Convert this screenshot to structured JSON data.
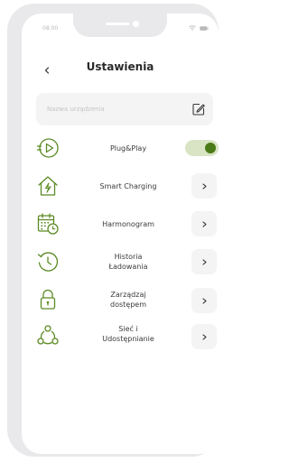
{
  "status_bar": {
    "time": "08.00"
  },
  "header": {
    "title": "Ustawienia"
  },
  "device_name": {
    "placeholder": "Nazwa urządzenia"
  },
  "accent_color": "#5a8a22",
  "settings": [
    {
      "label": "Plug&Play",
      "icon": "plug-icon",
      "control": "toggle",
      "enabled": true
    },
    {
      "label": "Smart Charging",
      "icon": "smart-home-icon",
      "control": "chevron"
    },
    {
      "label": "Harmonogram",
      "icon": "calendar-clock-icon",
      "control": "chevron"
    },
    {
      "label": "Historia\nŁadowania",
      "icon": "history-icon",
      "control": "chevron"
    },
    {
      "label": "Zarządzaj\ndostępem",
      "icon": "lock-icon",
      "control": "chevron"
    },
    {
      "label": "Sieć i\nUdostępnianie",
      "icon": "share-icon",
      "control": "chevron"
    }
  ]
}
